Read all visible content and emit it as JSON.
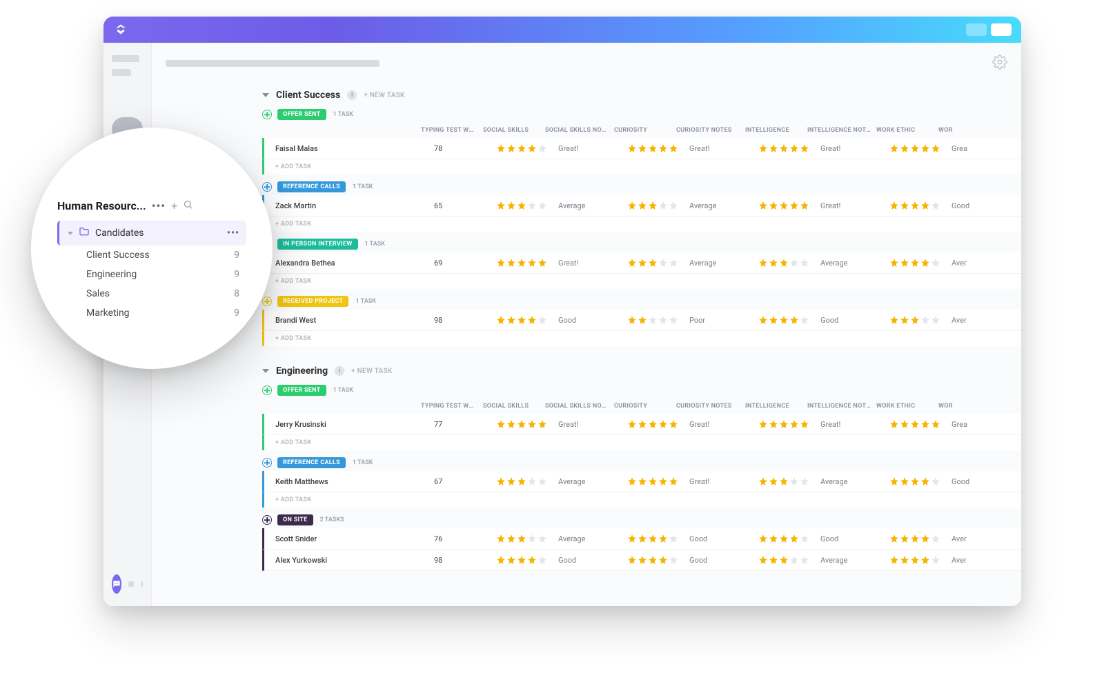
{
  "columns": {
    "typing": "TYPING TEST WPM",
    "social": "SOCIAL SKILLS",
    "social_notes": "SOCIAL SKILLS NOTES",
    "curiosity": "CURIOSITY",
    "curiosity_notes": "CURIOSITY NOTES",
    "intelligence": "INTELLIGENCE",
    "intelligence_notes": "INTELLIGENCE NOTES",
    "work_ethic": "WORK ETHIC",
    "work_partial": "WOR"
  },
  "labels": {
    "new_task": "+ NEW TASK",
    "add_task": "+ ADD TASK",
    "one_task": "1 TASK",
    "two_tasks": "2 TASKS"
  },
  "groups": [
    {
      "title": "Client Success",
      "statuses": [
        {
          "label": "OFFER SENT",
          "color": "green",
          "count": "1 TASK",
          "tasks": [
            {
              "name": "Faisal Malas",
              "wpm": "78",
              "social": 4,
              "social_note": "Great!",
              "curiosity": 5,
              "curiosity_note": "Great!",
              "intel": 5,
              "intel_note": "Great!",
              "ethic": 5,
              "ethic_note": "Grea"
            }
          ]
        },
        {
          "label": "REFERENCE CALLS",
          "color": "blue",
          "count": "1 TASK",
          "tasks": [
            {
              "name": "Zack Martin",
              "wpm": "65",
              "social": 3,
              "social_note": "Average",
              "curiosity": 3,
              "curiosity_note": "Average",
              "intel": 5,
              "intel_note": "Great!",
              "ethic": 4,
              "ethic_note": "Good"
            }
          ]
        },
        {
          "label": "IN PERSON INTERVIEW",
          "color": "teal",
          "count": "1 TASK",
          "tasks": [
            {
              "name": "Alexandra Bethea",
              "wpm": "69",
              "social": 5,
              "social_note": "Great!",
              "curiosity": 3,
              "curiosity_note": "Average",
              "intel": 3,
              "intel_note": "Average",
              "ethic": 4,
              "ethic_note": "Aver"
            }
          ]
        },
        {
          "label": "RECEIVED PROJECT",
          "color": "yellow",
          "count": "1 TASK",
          "tasks": [
            {
              "name": "Brandi West",
              "wpm": "98",
              "social": 4,
              "social_note": "Good",
              "curiosity": 2,
              "curiosity_note": "Poor",
              "intel": 4,
              "intel_note": "Good",
              "ethic": 3,
              "ethic_note": "Aver"
            }
          ]
        }
      ]
    },
    {
      "title": "Engineering",
      "statuses": [
        {
          "label": "OFFER SENT",
          "color": "green",
          "count": "1 TASK",
          "tasks": [
            {
              "name": "Jerry Krusinski",
              "wpm": "77",
              "social": 5,
              "social_note": "Great!",
              "curiosity": 5,
              "curiosity_note": "Great!",
              "intel": 5,
              "intel_note": "Great!",
              "ethic": 5,
              "ethic_note": "Grea"
            }
          ]
        },
        {
          "label": "REFERENCE CALLS",
          "color": "blue",
          "count": "1 TASK",
          "tasks": [
            {
              "name": "Keith Matthews",
              "wpm": "67",
              "social": 3,
              "social_note": "Average",
              "curiosity": 5,
              "curiosity_note": "Great!",
              "intel": 3,
              "intel_note": "Average",
              "ethic": 4,
              "ethic_note": "Good"
            }
          ]
        },
        {
          "label": "ON SITE",
          "color": "purple",
          "count": "2 TASKS",
          "tasks": [
            {
              "name": "Scott Snider",
              "wpm": "76",
              "social": 3,
              "social_note": "Average",
              "curiosity": 4,
              "curiosity_note": "Good",
              "intel": 4,
              "intel_note": "Good",
              "ethic": 4,
              "ethic_note": "Aver"
            },
            {
              "name": "Alex Yurkowski",
              "wpm": "98",
              "social": 4,
              "social_note": "Good",
              "curiosity": 4,
              "curiosity_note": "Good",
              "intel": 3,
              "intel_note": "Average",
              "ethic": 4,
              "ethic_note": "Aver"
            }
          ]
        }
      ]
    }
  ],
  "magnifier": {
    "title": "Human Resourc...",
    "active": "Candidates",
    "subs": [
      {
        "name": "Client Success",
        "count": "9"
      },
      {
        "name": "Engineering",
        "count": "9"
      },
      {
        "name": "Sales",
        "count": "8"
      },
      {
        "name": "Marketing",
        "count": "9"
      }
    ]
  }
}
